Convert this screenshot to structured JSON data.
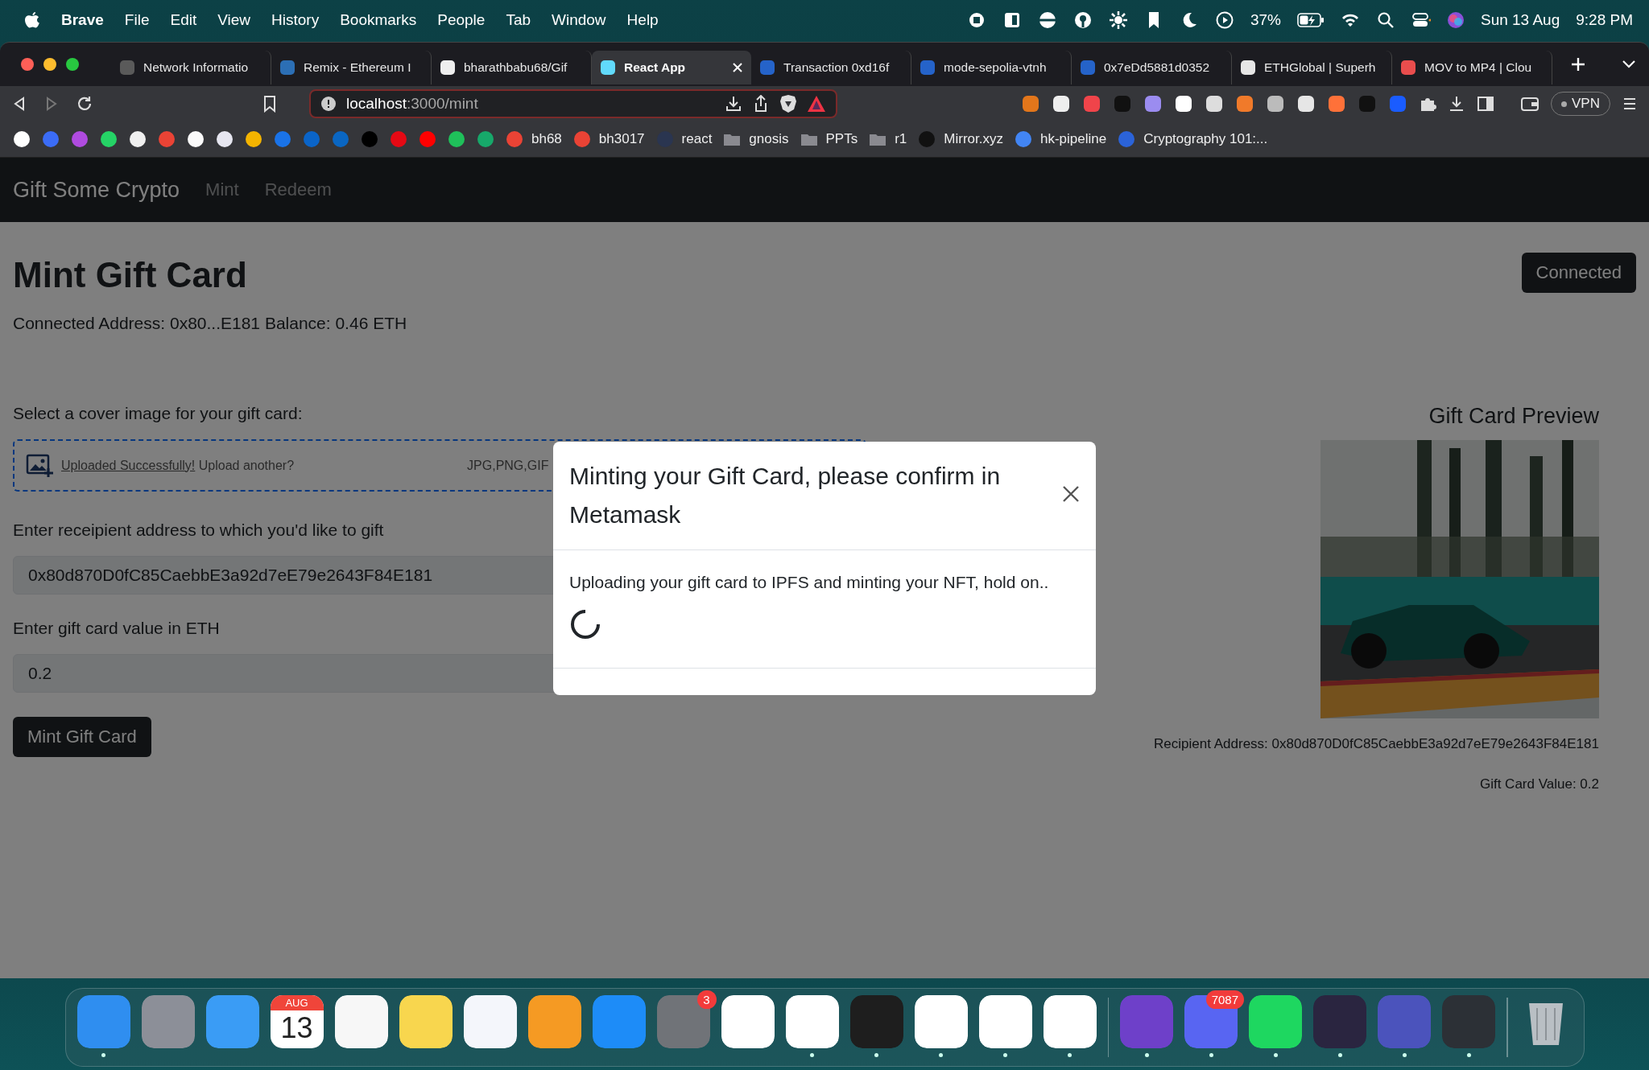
{
  "menu_bar": {
    "app": "Brave",
    "menus": [
      "File",
      "Edit",
      "View",
      "History",
      "Bookmarks",
      "People",
      "Tab",
      "Window",
      "Help"
    ],
    "battery": "37%",
    "date": "Sun 13 Aug",
    "time": "9:28 PM"
  },
  "browser": {
    "tabs": [
      {
        "title": "Network Informatio",
        "selected": false
      },
      {
        "title": "Remix - Ethereum I",
        "selected": false
      },
      {
        "title": "bharathbabu68/Gif",
        "selected": false
      },
      {
        "title": "React App",
        "selected": true
      },
      {
        "title": "Transaction 0xd16f",
        "selected": false
      },
      {
        "title": "mode-sepolia-vtnh",
        "selected": false
      },
      {
        "title": "0x7eDd5881d0352",
        "selected": false
      },
      {
        "title": "ETHGlobal | Superh",
        "selected": false
      },
      {
        "title": "MOV to MP4 | Clou",
        "selected": false
      }
    ],
    "address": {
      "host": "localhost",
      "path": ":3000/mint"
    },
    "vpn": "VPN",
    "bookmarks": [
      {
        "kind": "site",
        "color": "#ffffff"
      },
      {
        "kind": "site",
        "color": "#3b6cf6"
      },
      {
        "kind": "site",
        "color": "#b04be0"
      },
      {
        "kind": "site",
        "color": "#25d366"
      },
      {
        "kind": "site",
        "color": "#f0f0f0"
      },
      {
        "kind": "site",
        "color": "#ea4335"
      },
      {
        "kind": "site",
        "color": "#fafafa"
      },
      {
        "kind": "site",
        "color": "#e6e6f0"
      },
      {
        "kind": "site",
        "color": "#f4b400"
      },
      {
        "kind": "site",
        "color": "#1a73e8"
      },
      {
        "kind": "site",
        "color": "#0a64c8"
      },
      {
        "kind": "site",
        "color": "#0a66c2"
      },
      {
        "kind": "site",
        "color": "#000000"
      },
      {
        "kind": "site",
        "color": "#e50914"
      },
      {
        "kind": "site",
        "color": "#ff0000"
      },
      {
        "kind": "site",
        "color": "#1fc05a"
      },
      {
        "kind": "site",
        "color": "#17a86a"
      },
      {
        "kind": "site",
        "color": "#ea4335",
        "label": "bh68"
      },
      {
        "kind": "site",
        "color": "#ea4335",
        "label": "bh3017"
      },
      {
        "kind": "site",
        "color": "#2a3550",
        "label": "react"
      },
      {
        "kind": "folder",
        "color": "#8a8a90",
        "label": "gnosis"
      },
      {
        "kind": "folder",
        "color": "#8a8a90",
        "label": "PPTs"
      },
      {
        "kind": "folder",
        "color": "#8a8a90",
        "label": "r1"
      },
      {
        "kind": "site",
        "color": "#111111",
        "label": "Mirror.xyz"
      },
      {
        "kind": "site",
        "color": "#4285f4",
        "label": "hk-pipeline"
      },
      {
        "kind": "site",
        "color": "#2b63d9",
        "label": "Cryptography 101:..."
      }
    ]
  },
  "app": {
    "brand": "Gift Some Crypto",
    "nav": [
      "Mint",
      "Redeem"
    ],
    "page_title": "Mint Gift Card",
    "connect_button": "Connected",
    "account_line": "Connected Address: 0x80...E181 Balance: 0.46 ETH",
    "cover_label": "Select a cover image for your gift card:",
    "upload": {
      "link": "Uploaded Successfully!",
      "text": "Upload another?",
      "types": "JPG,PNG,GIF"
    },
    "recipient": {
      "label": "Enter receipient address to which you'd like to gift",
      "value": "0x80d870D0fC85CaebbE3a92d7eE79e2643F84E181"
    },
    "amount": {
      "label": "Enter gift card value in ETH",
      "value": "0.2"
    },
    "mint_button": "Mint Gift Card",
    "preview": {
      "title": "Gift Card Preview",
      "recipient": "Recipient Address: 0x80d870D0fC85CaebbE3a92d7eE79e2643F84E181",
      "value": "Gift Card Value: 0.2"
    }
  },
  "modal": {
    "title": "Minting your Gift Card, please confirm in Metamask",
    "message": "Uploading your gift card to IPFS and minting your NFT, hold on..",
    "loading": true
  },
  "dock": [
    {
      "kind": "app",
      "color": "#2f8ef0",
      "running": true
    },
    {
      "kind": "app",
      "color": "#8c8f98",
      "running": false
    },
    {
      "kind": "app",
      "color": "#3a9cf5",
      "running": false
    },
    {
      "kind": "calendar",
      "color": "#ffffff",
      "running": false,
      "month": "AUG",
      "day": "13"
    },
    {
      "kind": "app",
      "color": "#f7f7f7",
      "running": false
    },
    {
      "kind": "app",
      "color": "#f8d64e",
      "running": false
    },
    {
      "kind": "app",
      "color": "#f4f6fb",
      "running": false
    },
    {
      "kind": "app",
      "color": "#f59a23",
      "running": false
    },
    {
      "kind": "app",
      "color": "#1d8cf8",
      "running": false
    },
    {
      "kind": "app",
      "color": "#707378",
      "running": false,
      "badge": "3"
    },
    {
      "kind": "app",
      "color": "#ffffff",
      "running": false
    },
    {
      "kind": "app",
      "color": "#ffffff",
      "running": true
    },
    {
      "kind": "app",
      "color": "#1e1e1e",
      "running": true
    },
    {
      "kind": "app",
      "color": "#ffffff",
      "running": true
    },
    {
      "kind": "app",
      "color": "#ffffff",
      "running": true
    },
    {
      "kind": "app",
      "color": "#ffffff",
      "running": true
    },
    {
      "kind": "separator"
    },
    {
      "kind": "app",
      "color": "#6e40c9",
      "running": true
    },
    {
      "kind": "app",
      "color": "#5865f2",
      "running": true,
      "badge": "7087"
    },
    {
      "kind": "app",
      "color": "#1ed760",
      "running": true
    },
    {
      "kind": "app",
      "color": "#2a2540",
      "running": true
    },
    {
      "kind": "app",
      "color": "#4b53bc",
      "running": true
    },
    {
      "kind": "app",
      "color": "#2c3036",
      "running": true
    },
    {
      "kind": "separator"
    },
    {
      "kind": "trash",
      "running": false
    }
  ]
}
